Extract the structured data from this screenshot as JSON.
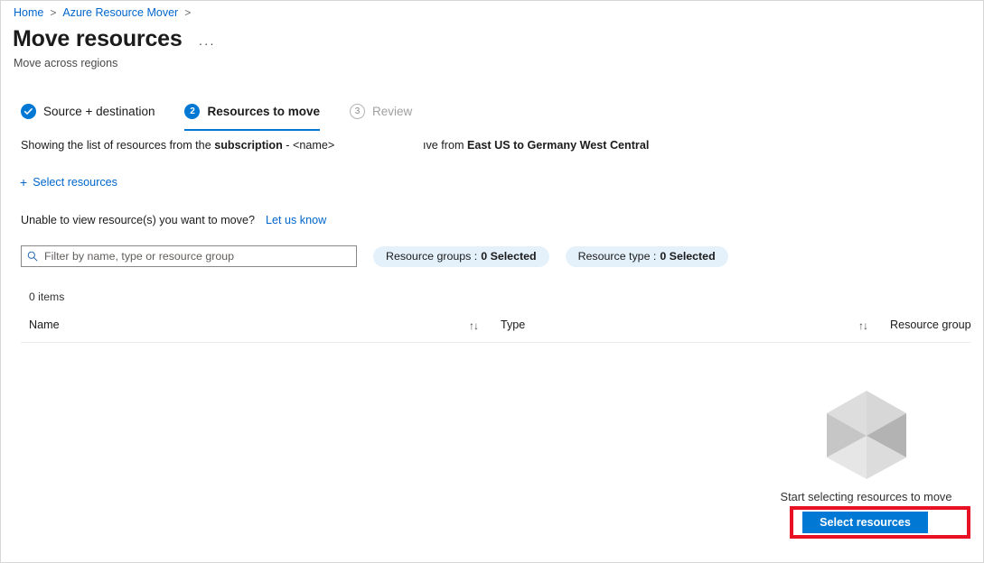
{
  "breadcrumb": {
    "items": [
      {
        "label": "Home"
      },
      {
        "label": "Azure Resource Mover"
      }
    ],
    "separator": ">"
  },
  "header": {
    "title": "Move resources",
    "subtitle": "Move across regions",
    "more_menu": "···"
  },
  "steps": [
    {
      "badge": "✓",
      "label": "Source + destination",
      "state": "done"
    },
    {
      "badge": "2",
      "label": "Resources to move",
      "state": "current"
    },
    {
      "badge": "3",
      "label": "Review",
      "state": "todo"
    }
  ],
  "description": {
    "prefix": "Showing the list of resources from the ",
    "bold_subscription": "subscription",
    "middle": " - <name>",
    "fragment_prefix": "ıve from ",
    "bold_regions": "East US to Germany West Central"
  },
  "commands": {
    "select_resources_link": "Select resources",
    "plus_icon": "+"
  },
  "help": {
    "question": "Unable to view resource(s) you want to move?",
    "link": "Let us know"
  },
  "filters": {
    "search_placeholder": "Filter by name, type or resource group",
    "search_value": "",
    "pills": [
      {
        "label": "Resource groups :",
        "value": "0 Selected"
      },
      {
        "label": "Resource type :",
        "value": "0 Selected"
      }
    ]
  },
  "table": {
    "item_count": "0 items",
    "columns": [
      {
        "label": "Name",
        "sortable": true
      },
      {
        "label": "Type",
        "sortable": true
      },
      {
        "label": "Resource group",
        "sortable": false
      }
    ],
    "sort_icon": "↑↓",
    "rows": []
  },
  "empty_state": {
    "message": "Start selecting resources to move",
    "button_label": "Select resources",
    "cube_icon": "cube-icon"
  },
  "colors": {
    "accent": "#0078d4",
    "link": "#0066cc",
    "pill_bg": "#e4f1fb",
    "annotation_red": "#e81123",
    "muted_text": "#a0a0a0"
  }
}
